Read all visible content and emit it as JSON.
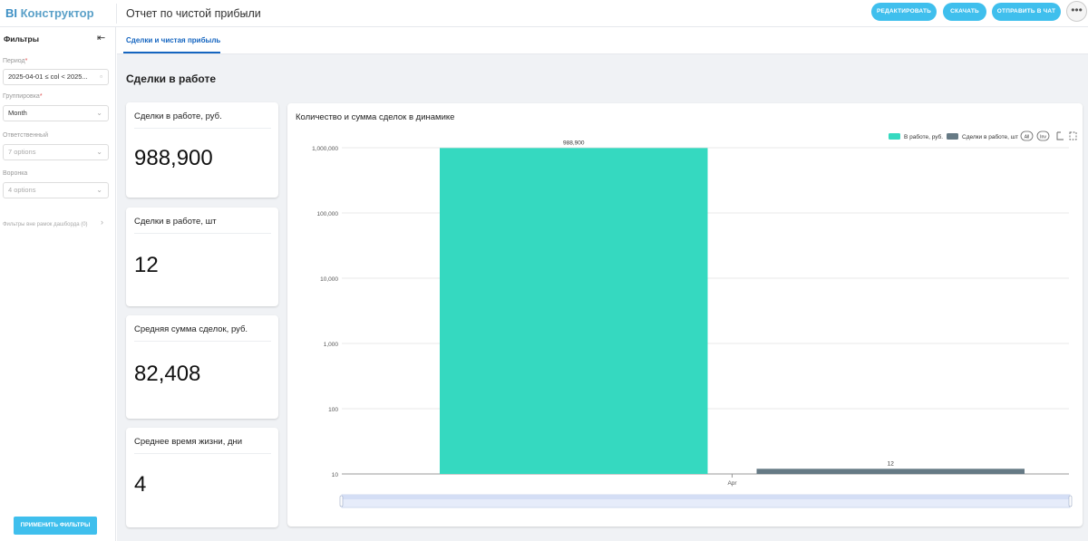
{
  "header": {
    "logo_bi": "BI",
    "logo_text": "Конструктор",
    "report_title": "Отчет по чистой прибыли",
    "buttons": {
      "edit": "Редактировать",
      "download": "Скачать",
      "send": "Отправить в чат"
    }
  },
  "sidebar": {
    "title": "Фильтры",
    "period": {
      "label": "Период",
      "value": "2025-04-01 ≤ col < 2025..."
    },
    "grouping": {
      "label": "Группировка",
      "value": "Month"
    },
    "responsible": {
      "label": "Ответственный",
      "placeholder": "7 options"
    },
    "funnel": {
      "label": "Воронка",
      "placeholder": "4 options"
    },
    "outside": "Фильтры вне рамок дашборда (0)",
    "apply": "Применить фильтры"
  },
  "tabs": [
    {
      "label": "Сделки и чистая прибыль",
      "active": true
    }
  ],
  "section_title": "Сделки в работе",
  "kpis": [
    {
      "title": "Сделки в работе, руб.",
      "value": "988,900"
    },
    {
      "title": "Сделки в работе, шт",
      "value": "12"
    },
    {
      "title": "Средняя сумма сделок, руб.",
      "value": "82,408"
    },
    {
      "title": "Среднее время жизни, дни",
      "value": "4"
    }
  ],
  "chart_data": {
    "type": "bar",
    "title": "Количество и сумма сделок в динамике",
    "categories": [
      "Apr"
    ],
    "y_scale": "log",
    "ylim": [
      10,
      1000000
    ],
    "y_ticks": [
      "10",
      "100",
      "1,000",
      "10,000",
      "100,000",
      "1,000,000"
    ],
    "series": [
      {
        "name": "В работе, руб.",
        "values": [
          988900
        ],
        "label": "988,900",
        "color": "#35d9c0"
      },
      {
        "name": "Сделки в работе, шт",
        "values": [
          12
        ],
        "label": "12",
        "color": "#667a85"
      }
    ],
    "legend_position": "top-right",
    "legend_controls": [
      "All",
      "Inv"
    ],
    "grid": true
  }
}
